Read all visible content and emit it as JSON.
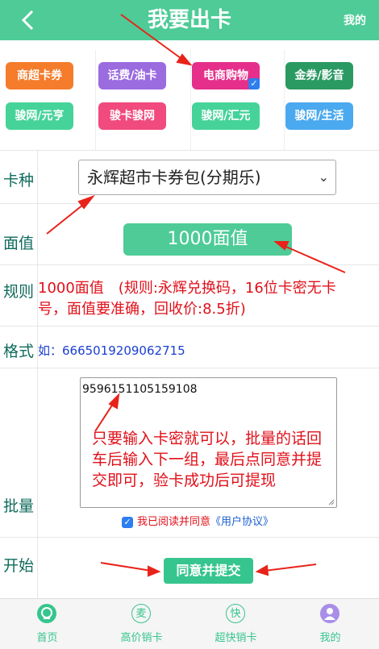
{
  "header": {
    "title": "我要出卡",
    "right_link": "我的"
  },
  "categories": [
    {
      "label": "商超卡券",
      "color": "#f57c2b",
      "selected": false
    },
    {
      "label": "话费/油卡",
      "color": "#9b6be0",
      "selected": false
    },
    {
      "label": "电商购物",
      "color": "#e52f8a",
      "selected": true
    },
    {
      "label": "金券/影音",
      "color": "#2a9a62",
      "selected": false
    },
    {
      "label": "骏网/元亨",
      "color": "#45d39a",
      "selected": false
    },
    {
      "label": "骏卡骏网",
      "color": "#f04a7e",
      "selected": false
    },
    {
      "label": "骏网/汇元",
      "color": "#45d39a",
      "selected": false
    },
    {
      "label": "骏网/生活",
      "color": "#4aa9ef",
      "selected": false
    }
  ],
  "form": {
    "card_type": {
      "label": "卡种",
      "value": "永辉超市卡券包(分期乐)"
    },
    "face_value": {
      "label": "面值",
      "value": "1000面值"
    },
    "rule": {
      "label": "规则",
      "text": "1000面值　(规则:永辉兑换码，16位卡密无卡号，面值要准确，回收价:8.5折)"
    },
    "format": {
      "label": "格式",
      "text": "如：6665019209062715"
    },
    "batch": {
      "label": "批量",
      "value": "9596151105159108",
      "hint": "只要输入卡密就可以，批量的话回车后输入下一组，最后点同意并提交即可，验卡成功后可提现"
    },
    "agreement": {
      "text": "我已阅读并同意",
      "link": "《用户协议》",
      "checked": true
    },
    "start": {
      "label": "开始",
      "submit": "同意并提交"
    }
  },
  "tabbar": [
    {
      "label": "首页",
      "icon": "home-icon",
      "glyph": ""
    },
    {
      "label": "高价销卡",
      "icon": "mai-icon",
      "glyph": "麦"
    },
    {
      "label": "超快销卡",
      "icon": "kuai-icon",
      "glyph": "快"
    },
    {
      "label": "我的",
      "icon": "user-icon",
      "glyph": ""
    }
  ],
  "colors": {
    "brand": "#4ecb97",
    "alert": "#e0101a",
    "link": "#1a3fd1",
    "annotation_arrow": "#e8231a"
  }
}
